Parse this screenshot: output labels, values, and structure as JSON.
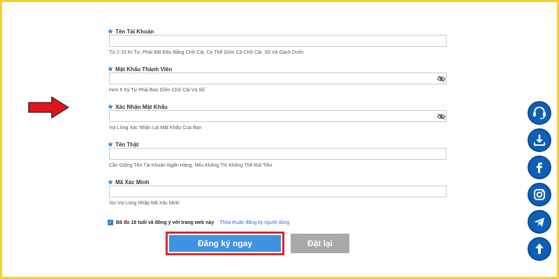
{
  "form": {
    "fields": [
      {
        "label": "Tên Tài Khoản",
        "value": "",
        "hint": "Từ 2-15 Kí Tự, Phải Bắt Đầu Bằng Chữ Cái, Có Thể Gồm Cả Chữ Cái, Số Và Gạch Dưới.",
        "password": false
      },
      {
        "label": "Mật Khẩu Thành Viên",
        "value": "",
        "hint": "Hơn 6 Ký Tự Phải Bao Gồm Chữ Cái Và Số",
        "password": true
      },
      {
        "label": "Xác Nhận Mật Khẩu",
        "value": "",
        "hint": "Vui Lòng Xác Nhận Lại Mật Khẩu Của Bạn",
        "password": true
      },
      {
        "label": "Tên Thật",
        "value": "",
        "hint": "Cần Giống Tên Tài Khoản Ngân Hàng, Nếu Không Thì Không Thể Rút Tiền",
        "password": false
      },
      {
        "label": "Mã Xác Minh",
        "value": "",
        "hint": "Xin Vui Lòng Nhập Mã Xác Minh",
        "password": false
      }
    ],
    "agreement": {
      "checked": true,
      "text": "Đã đủ 18 tuổi và đồng ý với trang web này",
      "link": "Thỏa thuận đăng ký người dùng"
    },
    "submit_label": "Đăng ký ngay",
    "reset_label": "Đặt lại"
  },
  "side_icons": [
    {
      "icon": "support-chat-icon"
    },
    {
      "icon": "download-icon"
    },
    {
      "icon": "facebook-icon"
    },
    {
      "icon": "instagram-icon"
    },
    {
      "icon": "telegram-icon"
    },
    {
      "icon": "scroll-top-icon"
    }
  ],
  "colors": {
    "accent": "#3f93e0",
    "highlight_border": "#d9262b",
    "arrow": "#e0141b",
    "frame": "#f2cf3a",
    "side_icon_bg": "#0f5fb6",
    "reset_button": "#a8a8a8"
  }
}
